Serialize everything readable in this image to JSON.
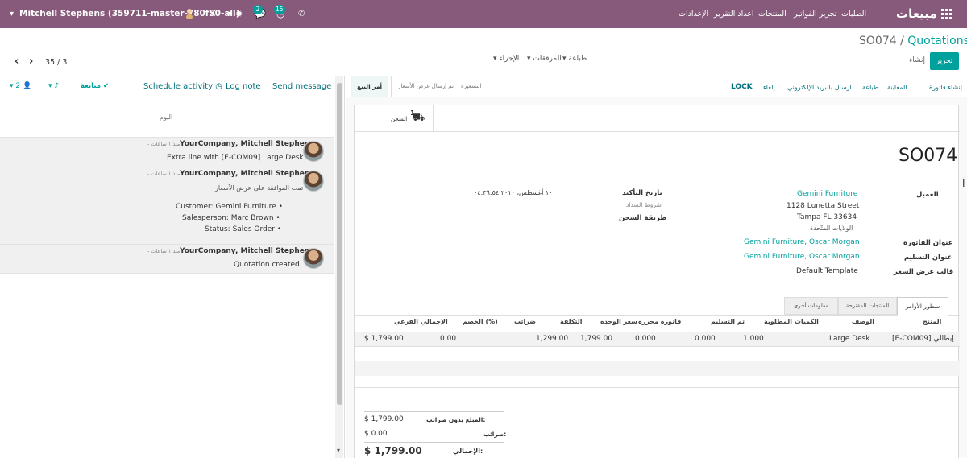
{
  "topbar": {
    "app_title": "مبيعات",
    "menu": [
      "الطلبات",
      "تحرير الفواتير",
      "المنتجات",
      "اعداد التقرير",
      "الإعدادات"
    ],
    "user": "Mitchell Stephens (359711-master-780f50-all)",
    "activity_badge": "15",
    "messages_badge": "2"
  },
  "control_panel": {
    "breadcrumb_parent": "Quotations",
    "breadcrumb_sep": "/",
    "breadcrumb_current": "SO074",
    "edit_button": "تحرير",
    "create_button": "إنشاء",
    "print_menu": "طباعة",
    "attachments_menu": "المرفقات",
    "action_menu": "الإجراء",
    "pager": "35 / 3"
  },
  "chatter": {
    "send_message": "Send message",
    "log_note": "Log note",
    "schedule_activity": "Schedule activity",
    "followers_count": "2",
    "following": "متابعة",
    "day_separator": "اليوم",
    "messages": [
      {
        "author": "YourCompany, Mitchell Stephens",
        "time": "- منذ ١ ساعات",
        "body": "Extra line with [E-COM09] Large Desk",
        "tracking": []
      },
      {
        "author": "YourCompany, Mitchell Stephens",
        "time": "- منذ ١ ساعات",
        "body": "تمت الموافقة على عرض الأسعار",
        "tracking": [
          "Customer: Gemini Furniture",
          "Salesperson: Marc Brown",
          "Status: Sales Order"
        ]
      },
      {
        "author": "YourCompany, Mitchell Stephens",
        "time": "- منذ ١ ساعات",
        "body": "Quotation created",
        "tracking": []
      }
    ]
  },
  "header_buttons": [
    "إنشاء فاتورة",
    "المعاينة",
    "طباعة",
    "ارسال بالبريد الإلكتروني",
    "إلغاء",
    "LOCK"
  ],
  "status_steps": [
    "أمر البيع",
    "تم إرسال عرض الأسعار",
    "التسعيرة"
  ],
  "smart_button": {
    "count": "1",
    "label": "الشحن"
  },
  "form": {
    "name": "SO074",
    "customer_label": "العميل",
    "customer_name": "Gemini Furniture",
    "customer_street": "1128 Lunetta Street",
    "customer_city": "Tampa FL 33634",
    "customer_country": "الولايات المتّحدة",
    "invoice_address_label": "عنوان الفاتورة",
    "invoice_address": "Gemini Furniture, Oscar Morgan",
    "delivery_address_label": "عنوان التسليم",
    "delivery_address": "Gemini Furniture, Oscar Morgan",
    "template_label": "قالب عرض السعر",
    "template_value": "Default Template",
    "confirmation_date_label": "تاريخ التأكيد",
    "confirmation_date": "١٠ أغسطس، ٢٠١٠ ٠٤:٣٦:٥٤",
    "payment_terms_label": "شروط السداد",
    "shipping_policy_label": "طريقة الشحن"
  },
  "tabs": [
    "سطور الأوامر",
    "المنتجات المقترحة",
    "معلومات أخرى"
  ],
  "order_lines": {
    "columns": [
      "المنتج",
      "الوصف",
      "الكميات المطلوبة",
      "تم التسليم",
      "فاتورة محررة",
      "سعر الوحدة",
      "التكلفة",
      "ضرائب",
      "الخصم (%)",
      "الإجمالي الفرعي"
    ],
    "rows": [
      {
        "product": "[E-COM09] إيطالي",
        "description": "Large Desk",
        "ordered_qty": "1.000",
        "delivered": "0.000",
        "invoiced": "0.000",
        "unit_price": "1,799.00",
        "cost": "1,299.00",
        "taxes": "",
        "discount": "0.00",
        "subtotal": "$ 1,799.00"
      }
    ]
  },
  "totals": {
    "untaxed_label": "المبلغ بدون ضرائب:",
    "untaxed_value": "$ 1,799.00",
    "taxes_label": "ضرائب:",
    "taxes_value": "$ 0.00",
    "total_label": "الإجمالي:",
    "total_value": "$ 1,799.00"
  },
  "colors": {
    "brand": "#875a7b",
    "accent": "#00a09d"
  }
}
